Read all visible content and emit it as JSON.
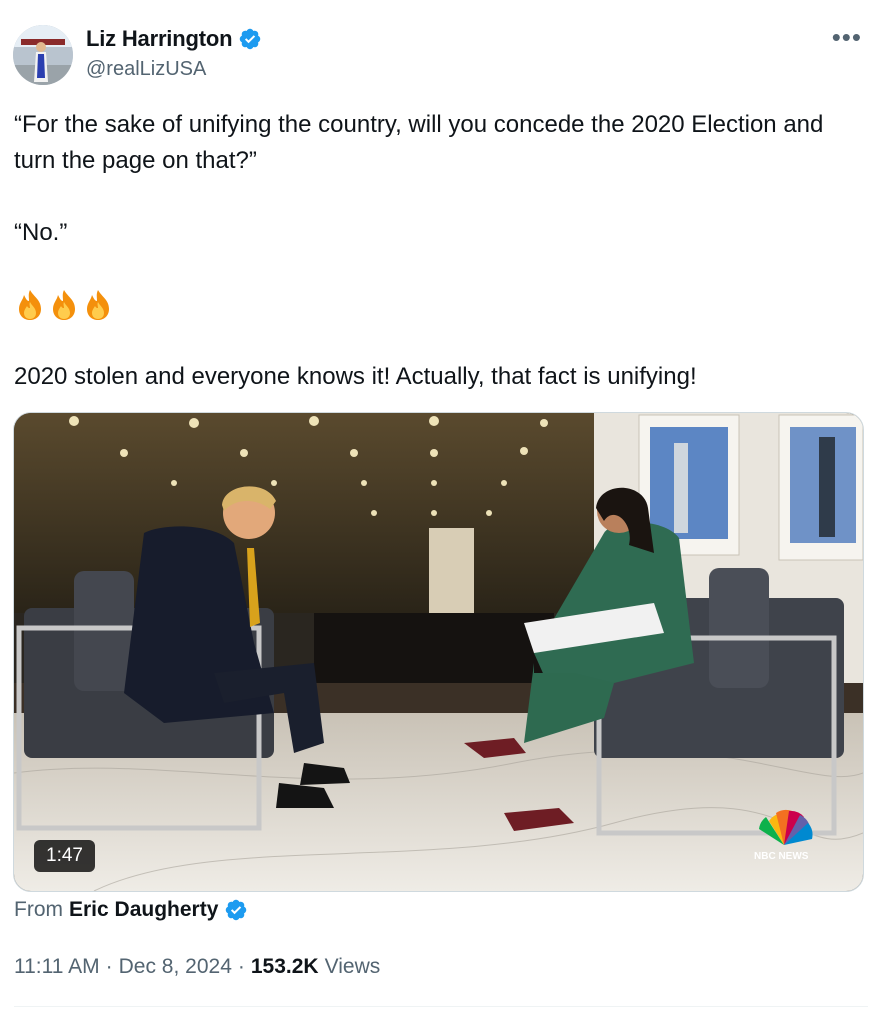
{
  "author": {
    "display_name": "Liz Harrington",
    "handle": "@realLizUSA",
    "verified_icon": "verified-badge-icon",
    "verified_color": "#1d9bf0"
  },
  "more_icon": "more-options-icon",
  "tweet": {
    "line1": "“For the sake of unifying the country, will you concede the 2020 Election and turn the page on that?”",
    "line2": "“No.”",
    "emoji": [
      "🔥",
      "🔥",
      "🔥"
    ],
    "line3": "2020 stolen and everyone knows it! Actually, that fact is unifying!"
  },
  "media": {
    "duration": "1:47",
    "watermark": "NBC NEWS"
  },
  "attribution": {
    "from_label": "From",
    "source_name": "Eric Daugherty",
    "verified_icon": "verified-badge-icon"
  },
  "meta": {
    "time": "11:11 AM",
    "separator": "·",
    "date": "Dec 8, 2024",
    "views_count": "153.2K",
    "views_label": "Views"
  }
}
